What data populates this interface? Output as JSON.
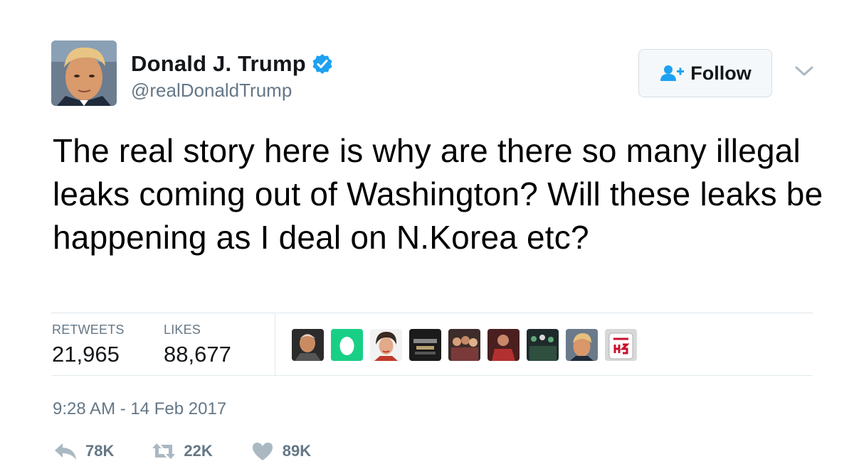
{
  "author": {
    "display_name": "Donald J. Trump",
    "handle": "@realDonaldTrump",
    "verified": true,
    "avatar_icon": "profile-photo"
  },
  "follow_button": {
    "label": "Follow",
    "icon": "add-user-icon"
  },
  "menu_icon": "chevron-down-icon",
  "tweet_text": "The real story here is why are there so many illegal leaks coming out of Washington? Will these leaks be happening as I deal on N.Korea etc?",
  "stats": {
    "retweets_label": "RETWEETS",
    "retweets_value": "21,965",
    "likes_label": "LIKES",
    "likes_value": "88,677"
  },
  "likers": [
    {
      "icon": "liker-avatar-1"
    },
    {
      "icon": "liker-avatar-egg"
    },
    {
      "icon": "liker-avatar-3"
    },
    {
      "icon": "liker-avatar-4"
    },
    {
      "icon": "liker-avatar-5"
    },
    {
      "icon": "liker-avatar-6"
    },
    {
      "icon": "liker-avatar-7"
    },
    {
      "icon": "liker-avatar-8"
    },
    {
      "icon": "liker-avatar-bulls-45"
    }
  ],
  "timestamp": "9:28 AM - 14 Feb 2017",
  "actions": {
    "reply_count": "78K",
    "retweet_count": "22K",
    "like_count": "89K"
  },
  "colors": {
    "verified_blue": "#1da1f2",
    "secondary_text": "#657786",
    "egg_green": "#19cf86"
  }
}
